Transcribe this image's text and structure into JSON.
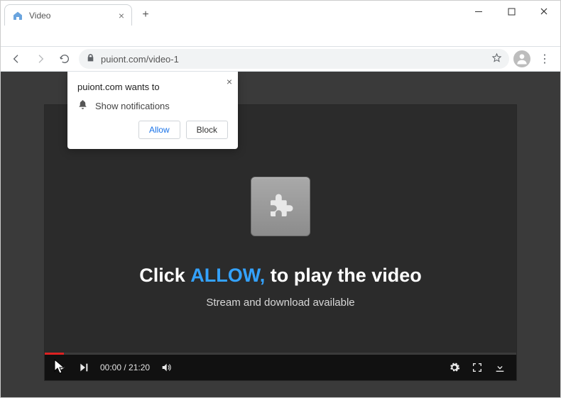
{
  "window": {
    "tab_title": "Video",
    "url_display": "puiont.com/video-1"
  },
  "notification": {
    "wants_to": "puiont.com wants to",
    "show_label": "Show notifications",
    "allow_label": "Allow",
    "block_label": "Block"
  },
  "player": {
    "headline_prefix": "Click ",
    "headline_allow": "ALLOW,",
    "headline_suffix": " to play the video",
    "subtext": "Stream and download available",
    "time_current": "00:00",
    "time_sep": " / ",
    "time_total": "21:20"
  }
}
